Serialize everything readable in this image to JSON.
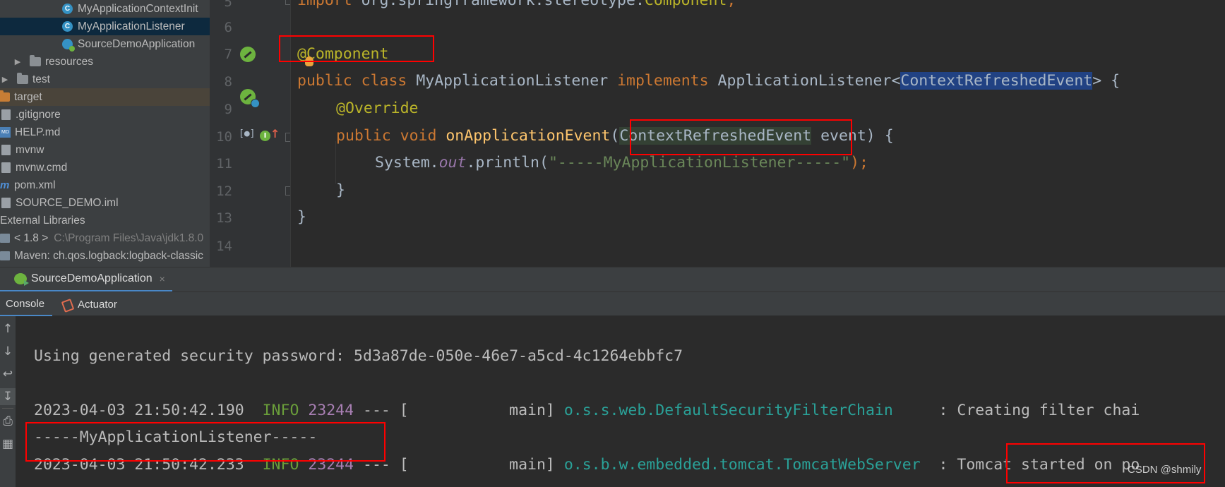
{
  "sidebar": {
    "items": [
      {
        "label": "MyApplicationContextInit",
        "icon": "class-icon"
      },
      {
        "label": "MyApplicationListener",
        "icon": "class-icon"
      },
      {
        "label": "SourceDemoApplication",
        "icon": "spring-boot-class-icon"
      },
      {
        "label": "resources",
        "icon": "folder-icon"
      },
      {
        "label": "test",
        "icon": "folder-icon"
      },
      {
        "label": "target",
        "icon": "folder-icon"
      },
      {
        "label": ".gitignore",
        "icon": "file-icon"
      },
      {
        "label": "HELP.md",
        "icon": "markdown-icon"
      },
      {
        "label": "mvnw",
        "icon": "file-icon"
      },
      {
        "label": "mvnw.cmd",
        "icon": "file-icon"
      },
      {
        "label": "pom.xml",
        "icon": "maven-icon"
      },
      {
        "label": "SOURCE_DEMO.iml",
        "icon": "file-icon"
      },
      {
        "label": "External Libraries",
        "icon": ""
      },
      {
        "label": "< 1.8 >",
        "sub": "C:\\Program Files\\Java\\jdk1.8.0",
        "icon": "library-icon"
      },
      {
        "label": "Maven: ch.qos.logback:logback-classic",
        "icon": "library-icon"
      }
    ]
  },
  "editor": {
    "line_numbers": [
      "5",
      "6",
      "7",
      "8",
      "9",
      "10",
      "11",
      "12",
      "13",
      "14"
    ],
    "lines": {
      "l5": {
        "kw": "import",
        "pkg": " org.springframework.stereotype.",
        "cls": "Component",
        "end": ";"
      },
      "l7": {
        "ann": "@Component"
      },
      "l8": {
        "kw1": "public",
        "kw2": "class",
        "name": "MyApplicationListener",
        "kw3": "implements",
        "iface": "ApplicationListener<",
        "generic": "ContextRefreshedEvent",
        "end": "> {"
      },
      "l9": {
        "ann": "@Override"
      },
      "l10": {
        "kw1": "public",
        "kw2": "void",
        "fn": "onApplicationEvent",
        "open": "(",
        "param_type": "ContextRefreshedEvent",
        "rest": " event) {"
      },
      "l11": {
        "obj": "System.",
        "field": "out",
        "call": ".println(",
        "str": "\"-----MyApplicationListener-----\"",
        "end": ");"
      },
      "l12": {
        "text": "}"
      },
      "l13": {
        "text": "}"
      }
    }
  },
  "run_window": {
    "tab_label": "SourceDemoApplication",
    "close_glyph": "×",
    "subtabs": [
      "Console",
      "Actuator"
    ],
    "toolbar_icons": [
      "arrow-up-icon",
      "arrow-down-icon",
      "soft-wrap-icon",
      "scroll-to-end-icon",
      "print-icon",
      "trash-icon"
    ]
  },
  "console": {
    "password_line": "Using generated security password: 5d3a87de-050e-46e7-a5cd-4c1264ebbfc7",
    "log1": {
      "ts": "2023-04-03 21:50:42.190",
      "level": "INFO",
      "pid": "23244",
      "sep": " --- [",
      "thread": "           main]",
      "logger": "o.s.s.web.DefaultSecurityFilterChain",
      "msg": "     : Creating filter chai"
    },
    "listener_line": "-----MyApplicationListener-----",
    "log2": {
      "ts": "2023-04-03 21:50:42.233",
      "level": "INFO",
      "pid": "23244",
      "sep": " --- [",
      "thread": "           main]",
      "logger": "o.s.b.w.embedded.tomcat.TomcatWebServer",
      "msg": "  : Tomcat started on po"
    }
  },
  "watermark": "CSDN @shmily"
}
